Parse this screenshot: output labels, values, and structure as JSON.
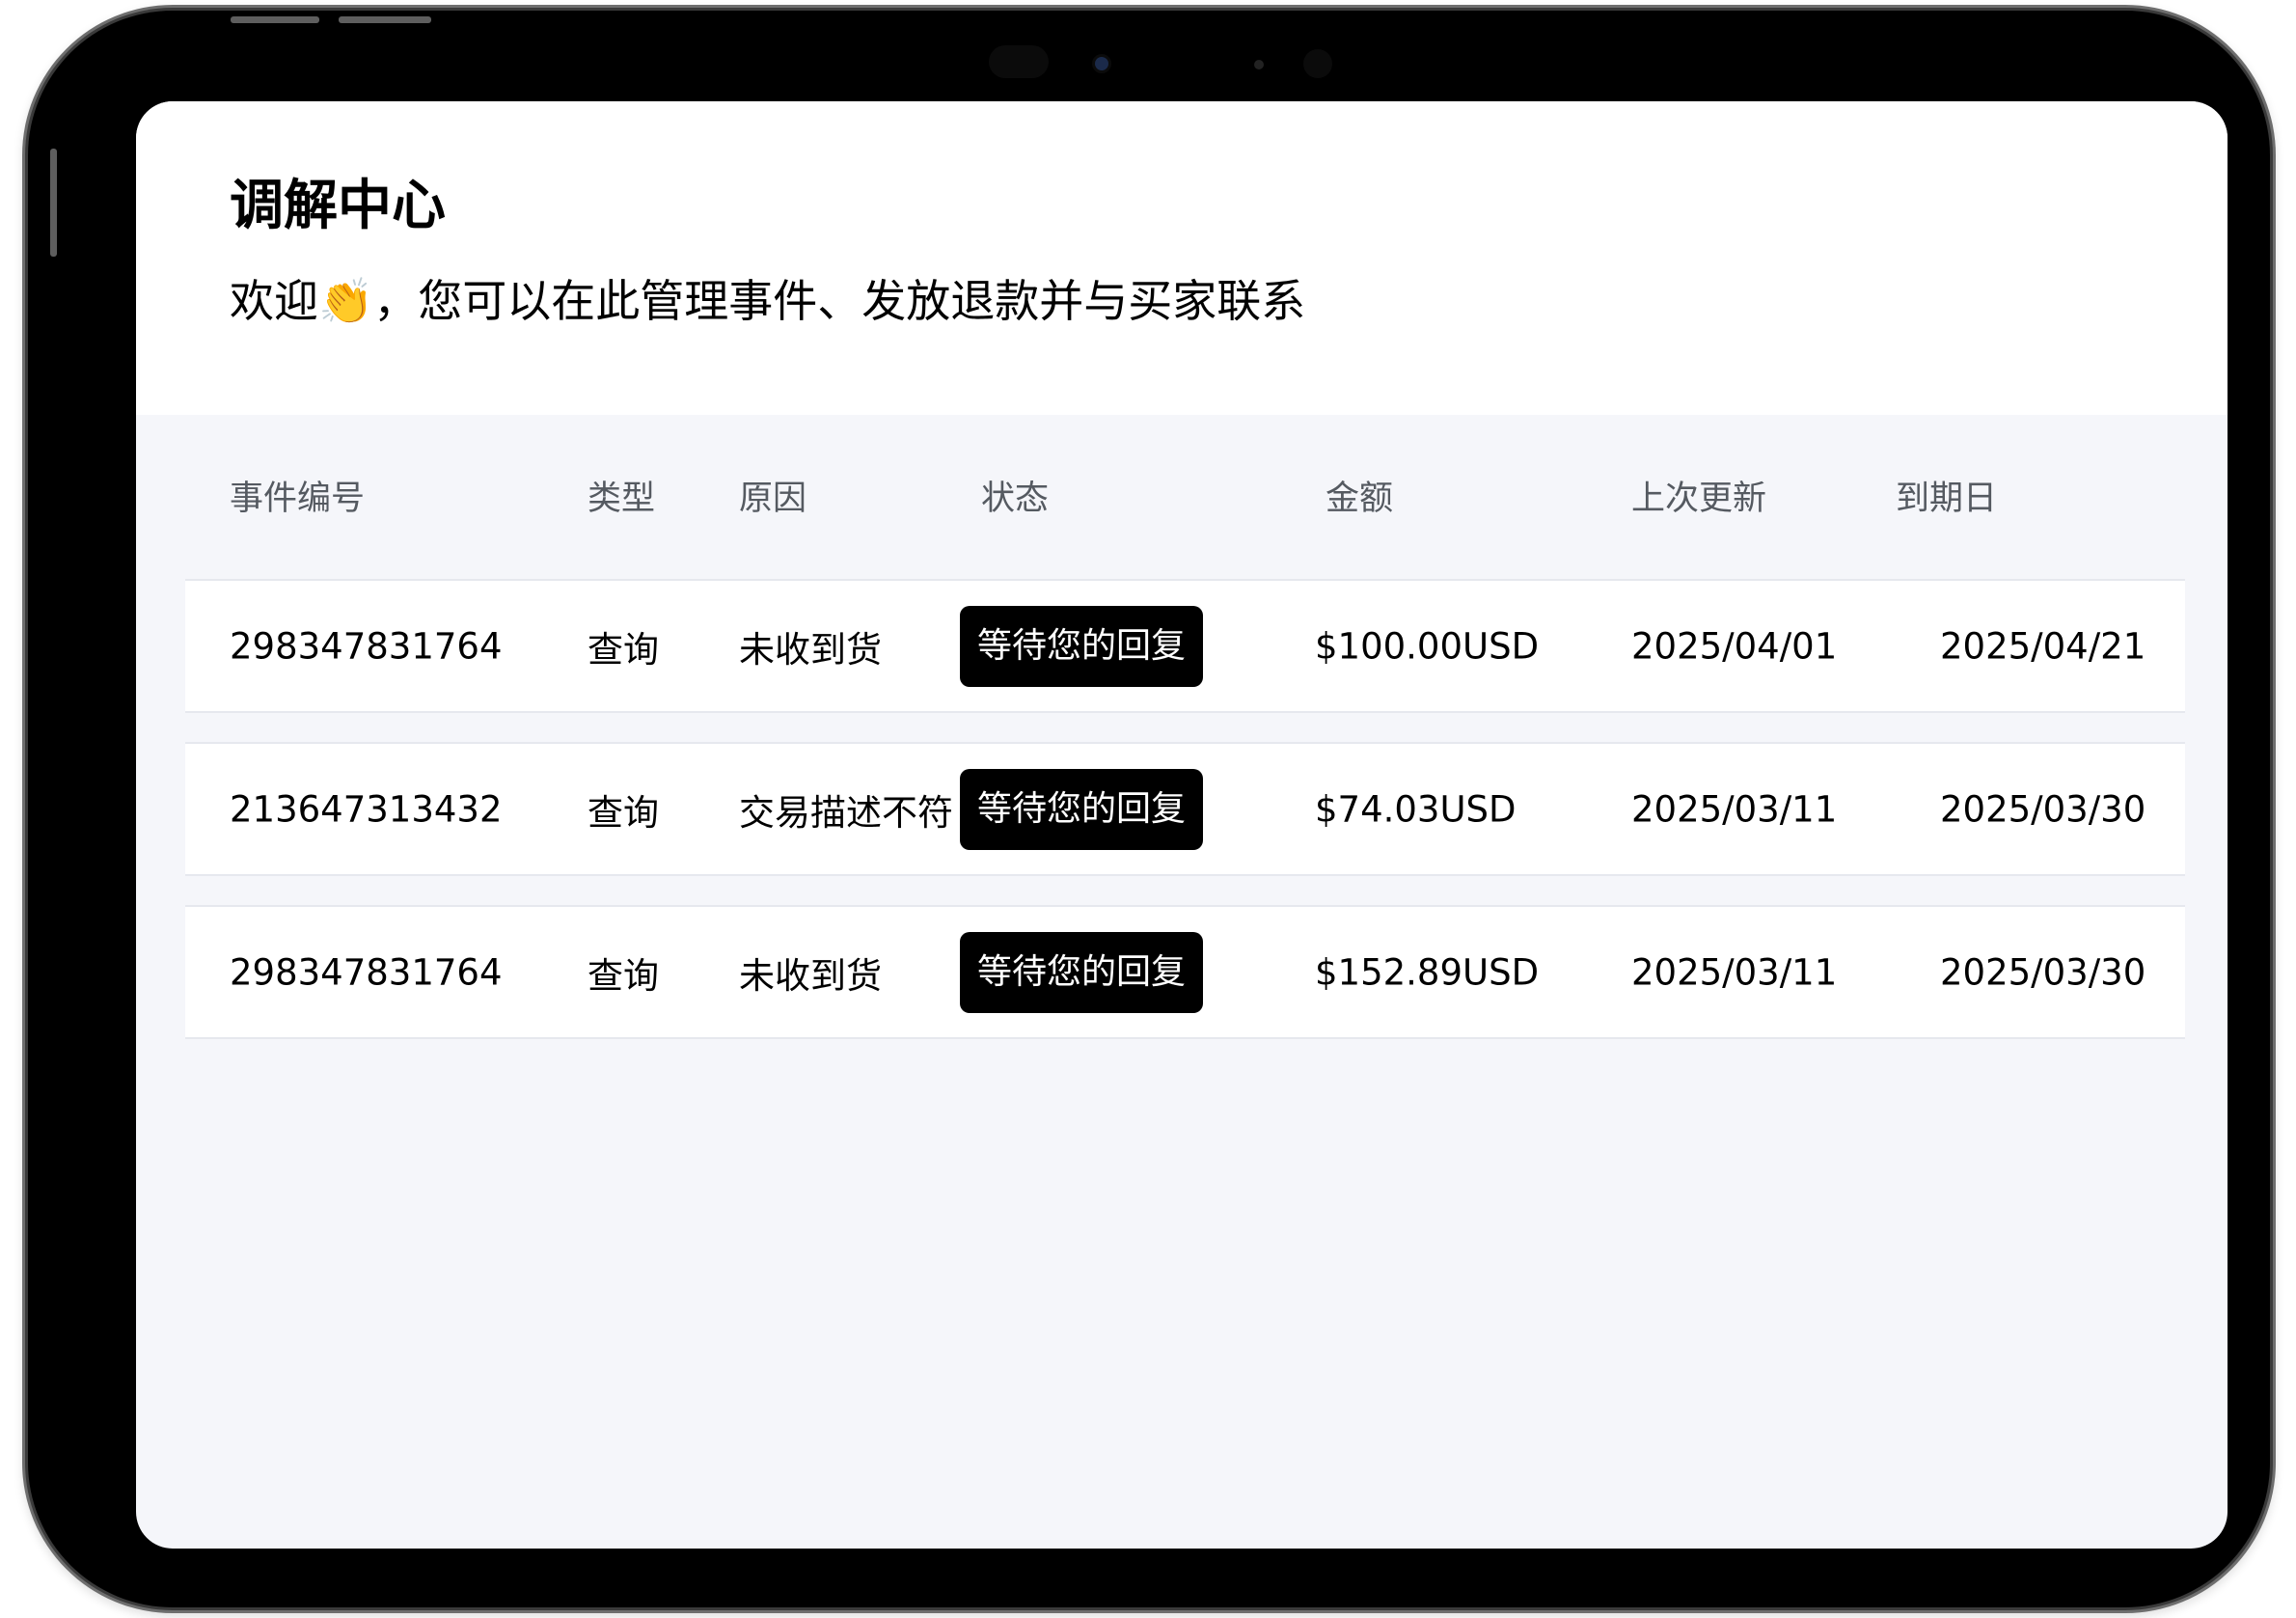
{
  "header": {
    "title": "调解中心",
    "subtitle": "欢迎👏，您可以在此管理事件、发放退款并与买家联系"
  },
  "table": {
    "columns": [
      "事件编号",
      "类型",
      "原因",
      "状态",
      "金额",
      "上次更新",
      "到期日"
    ],
    "rows": [
      {
        "id": "298347831764",
        "type": "查询",
        "reason": "未收到货",
        "status": "等待您的回复",
        "amount": "$100.00USD",
        "last_updated": "2025/04/01",
        "due_date": "2025/04/21"
      },
      {
        "id": "213647313432",
        "type": "查询",
        "reason": "交易描述不符",
        "status": "等待您的回复",
        "amount": "$74.03USD",
        "last_updated": "2025/03/11",
        "due_date": "2025/03/30"
      },
      {
        "id": "298347831764",
        "type": "查询",
        "reason": "未收到货",
        "status": "等待您的回复",
        "amount": "$152.89USD",
        "last_updated": "2025/03/11",
        "due_date": "2025/03/30"
      }
    ]
  },
  "colors": {
    "badge_bg": "#000000",
    "badge_text": "#ffffff",
    "page_bg": "#f5f6fa",
    "header_text": "#555a61"
  }
}
